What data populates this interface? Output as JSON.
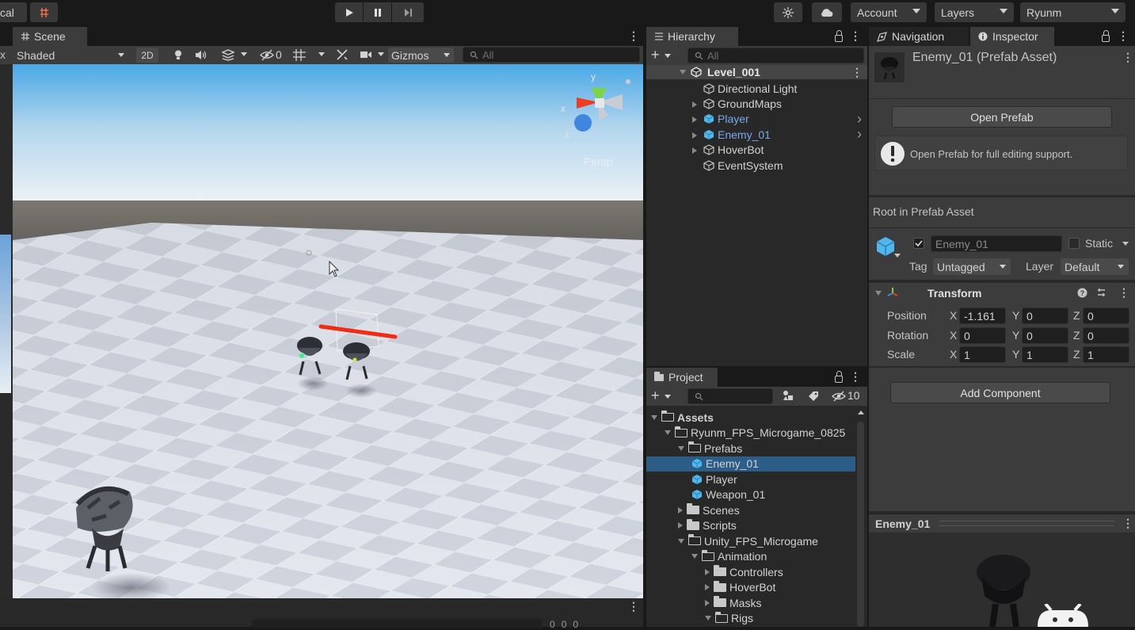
{
  "toolbar": {
    "left_label": "cal",
    "account_label": "Account",
    "layers_label": "Layers",
    "layout_label": "Ryunm"
  },
  "scene": {
    "tab_label": "Scene",
    "shading_mode": "Shaded",
    "mode_2d": "2D",
    "hidden_count": "0",
    "gizmos_label": "Gizmos",
    "search_placeholder": "All",
    "projection_label": "Persp",
    "left_edge_label": "x",
    "gizmo_x": "x",
    "gizmo_y": "y",
    "gizmo_z": "z"
  },
  "hierarchy": {
    "tab_label": "Hierarchy",
    "search_placeholder": "All",
    "root": "Level_001",
    "items": [
      {
        "label": "Directional Light",
        "color": "normal",
        "expandable": false
      },
      {
        "label": "GroundMaps",
        "color": "normal",
        "expandable": true
      },
      {
        "label": "Player",
        "color": "blue",
        "expandable": true
      },
      {
        "label": "Enemy_01",
        "color": "blue",
        "expandable": true
      },
      {
        "label": "HoverBot",
        "color": "normal",
        "expandable": true
      },
      {
        "label": "EventSystem",
        "color": "normal",
        "expandable": false
      }
    ]
  },
  "project": {
    "tab_label": "Project",
    "hidden_count": "10",
    "items": [
      {
        "label": "Assets",
        "level": 0,
        "type": "folder-open",
        "bold": true
      },
      {
        "label": "Ryunm_FPS_Microgame_0825",
        "level": 1,
        "type": "folder-open"
      },
      {
        "label": "Prefabs",
        "level": 2,
        "type": "folder-open"
      },
      {
        "label": "Enemy_01",
        "level": 3,
        "type": "prefab",
        "selected": true
      },
      {
        "label": "Player",
        "level": 3,
        "type": "prefab"
      },
      {
        "label": "Weapon_01",
        "level": 3,
        "type": "prefab"
      },
      {
        "label": "Scenes",
        "level": 2,
        "type": "folder"
      },
      {
        "label": "Scripts",
        "level": 2,
        "type": "folder"
      },
      {
        "label": "Unity_FPS_Microgame",
        "level": 2,
        "type": "folder-open"
      },
      {
        "label": "Animation",
        "level": 3,
        "type": "folder-open"
      },
      {
        "label": "Controllers",
        "level": 4,
        "type": "folder"
      },
      {
        "label": "HoverBot",
        "level": 4,
        "type": "folder"
      },
      {
        "label": "Masks",
        "level": 4,
        "type": "folder"
      },
      {
        "label": "Rigs",
        "level": 4,
        "type": "folder-open"
      }
    ]
  },
  "inspector": {
    "nav_tab_label": "Navigation",
    "inspector_tab_label": "Inspector",
    "asset_title": "Enemy_01 (Prefab Asset)",
    "open_prefab_label": "Open Prefab",
    "info_message": "Open Prefab for full editing support.",
    "root_label": "Root in Prefab Asset",
    "object_name": "Enemy_01",
    "static_label": "Static",
    "tag_label": "Tag",
    "tag_value": "Untagged",
    "layer_label": "Layer",
    "layer_value": "Default",
    "transform_label": "Transform",
    "position_label": "Position",
    "rotation_label": "Rotation",
    "scale_label": "Scale",
    "axis_x": "X",
    "axis_y": "Y",
    "axis_z": "Z",
    "position": {
      "x": "-1.161",
      "y": "0",
      "z": "0"
    },
    "rotation": {
      "x": "0",
      "y": "0",
      "z": "0"
    },
    "scale": {
      "x": "1",
      "y": "1",
      "z": "1"
    },
    "add_component_label": "Add Component",
    "preview_title": "Enemy_01"
  },
  "console": {
    "count_a": "0",
    "count_b": "0",
    "count_c": "0"
  },
  "colors": {
    "selection": "#2c5d87",
    "prefab_blue": "#7aa9ea",
    "sky_top": "#4aa8e6",
    "ground": "#dde1ea"
  }
}
